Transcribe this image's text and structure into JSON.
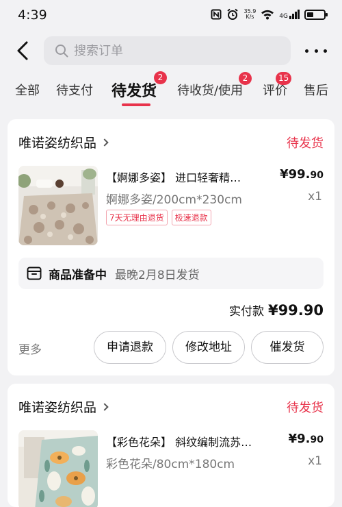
{
  "status_bar": {
    "time": "4:39",
    "speed_value": "35.9",
    "speed_unit": "K/s",
    "network": "4G"
  },
  "header": {
    "search_placeholder": "搜索订单",
    "icons": [
      "back-arrow-icon",
      "search-icon",
      "more-icon"
    ]
  },
  "tabs": [
    {
      "label": "全部"
    },
    {
      "label": "待支付"
    },
    {
      "label": "待发货",
      "badge": "2",
      "active": true
    },
    {
      "label": "待收货/使用",
      "badge": "2"
    },
    {
      "label": "评价",
      "badge": "15"
    },
    {
      "label": "售后"
    }
  ],
  "colors": {
    "accent": "#e8334b",
    "background": "#f2f2f4",
    "card": "#ffffff"
  },
  "orders": [
    {
      "shop": "唯诺姿纺织品",
      "status": "待发货",
      "product_title": "【婀娜多姿】 进口轻奢精…",
      "price_main": "¥99.",
      "price_cents": "90",
      "spec": "婀娜多姿/200cm*230cm",
      "qty": "x1",
      "tags": [
        "7天无理由退货",
        "极速退款"
      ],
      "shipping_status": "商品准备中",
      "shipping_note": "最晚2月8日发货",
      "paid_label": "实付款",
      "paid_amount": "¥99.90",
      "more_label": "更多",
      "actions": [
        "申请退款",
        "修改地址",
        "催发货"
      ]
    },
    {
      "shop": "唯诺姿纺织品",
      "status": "待发货",
      "product_title": "【彩色花朵】 斜纹编制流苏…",
      "price_main": "¥9.",
      "price_cents": "90",
      "spec": "彩色花朵/80cm*180cm",
      "qty": "x1"
    }
  ]
}
